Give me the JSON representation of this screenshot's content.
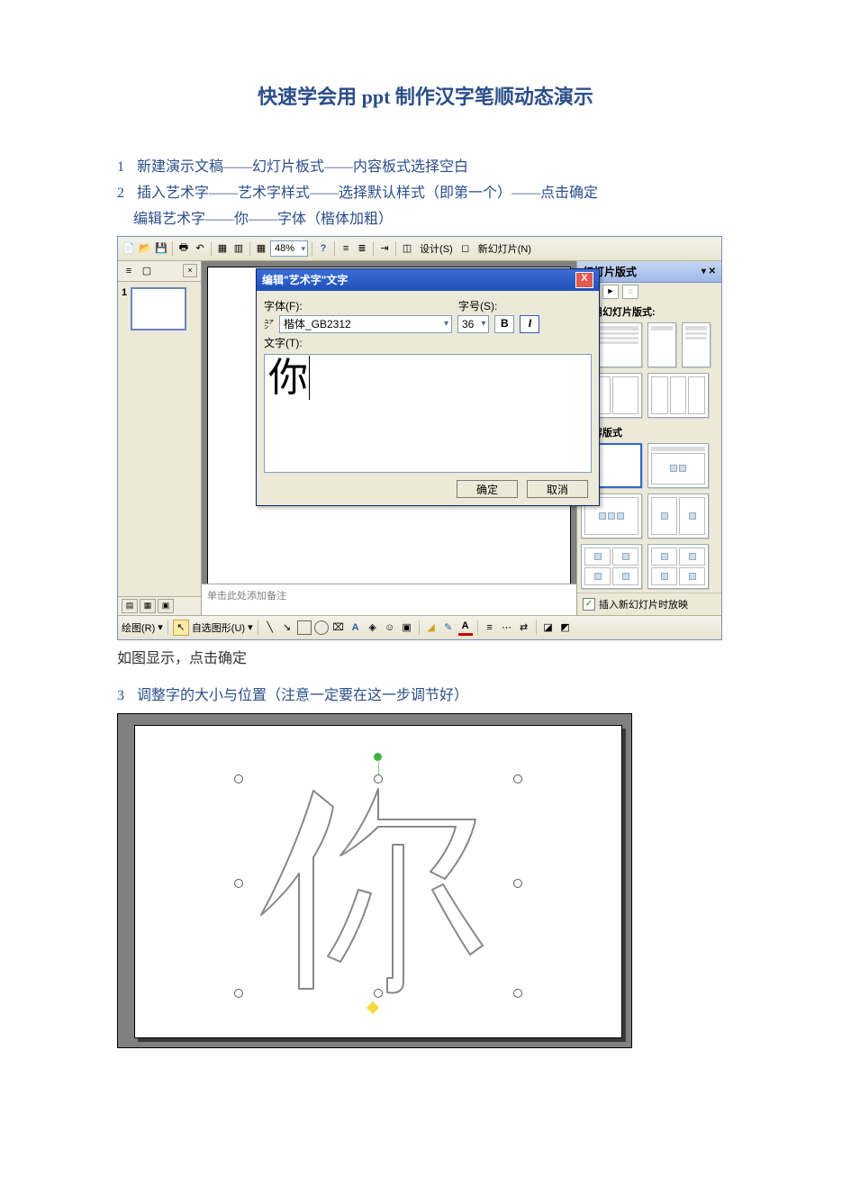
{
  "title": "快速学会用 ppt 制作汉字笔顺动态演示",
  "steps": {
    "s1_num": "1",
    "s1_text": "新建演示文稿——幻灯片板式——内容板式选择空白",
    "s2_num": "2",
    "s2_text": "插入艺术字——艺术字样式——选择默认样式（即第一个）——点击确定",
    "s2_text_b": "编辑艺术字——你——字体（楷体加粗）",
    "after1": "如图显示，点击确定",
    "s3_num": "3",
    "s3_text": "调整字的大小与位置（注意一定要在这一步调节好）"
  },
  "shot1": {
    "zoom": "48%",
    "design_link": "设计(S)",
    "newslide_link": "新幻灯片(N)",
    "thumb_num": "1",
    "notes_placeholder": "单击此处添加备注",
    "draw_label": "绘图(R)",
    "autoshape_label": "自选图形(U)",
    "dialog": {
      "title": "编辑\"艺术字\"文字",
      "font_label": "字体(F):",
      "font_value": "楷体_GB2312",
      "size_label": "字号(S):",
      "size_value": "36",
      "text_label": "文字(T):",
      "text_value": "你",
      "ok": "确定",
      "cancel": "取消"
    },
    "taskpane": {
      "header": "幻灯片版式",
      "apply_label": "应用幻灯片版式:",
      "content_label": "内容版式",
      "checkbox_label": "插入新幻灯片时放映"
    }
  }
}
